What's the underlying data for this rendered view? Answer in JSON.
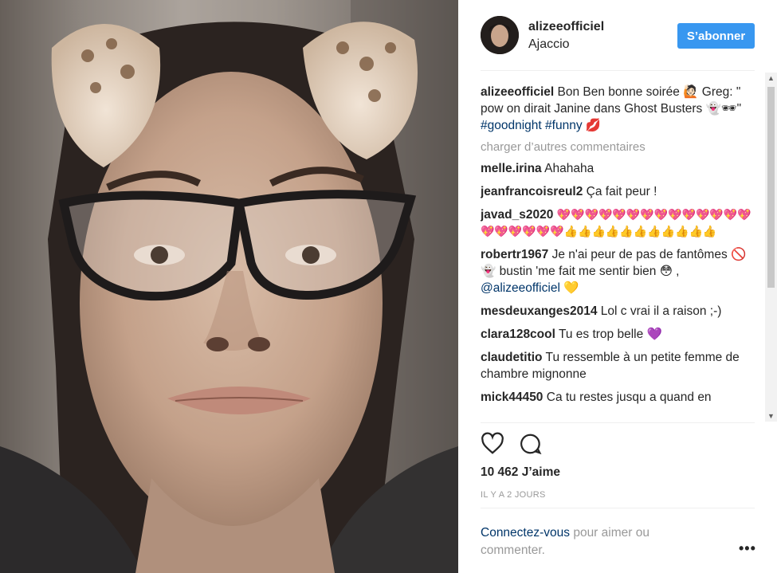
{
  "post": {
    "username": "alizeeofficiel",
    "location": "Ajaccio",
    "follow_label": "S’abonner",
    "caption": {
      "user": "alizeeofficiel",
      "text": "Bon Ben bonne soirée 🙋🏻 Greg: \" pow on dirait Janine dans Ghost Busters 👻🕶\" ",
      "tags": [
        "#goodnight",
        "#funny"
      ],
      "trail": " 💋"
    },
    "load_more": "charger d’autres commentaires",
    "comments": [
      {
        "user": "melle.irina",
        "text": "Ahahaha"
      },
      {
        "user": "jeanfrancoisreul2",
        "text": "Ça fait peur !"
      },
      {
        "user": "javad_s2020",
        "text": "💖💖💖💖💖💖💖💖💖💖💖💖💖💖💖💖💖💖💖💖👍👍👍👍👍👍👍👍👍👍👍"
      },
      {
        "user": "robertr1967",
        "text": "Je n'ai peur de pas de fantômes 🚫👻 bustin 'me fait me sentir bien 😳 , ",
        "mention": "@alizeeofficiel",
        "after": " 💛"
      },
      {
        "user": "mesdeuxanges2014",
        "text": "Lol c vrai il a raison ;-)"
      },
      {
        "user": "clara128cool",
        "text": "Tu es trop belle 💜"
      },
      {
        "user": "claudetitio",
        "text": "Tu ressemble à un petite femme de chambre mignonne"
      },
      {
        "user": "mick44450",
        "text": "Ca tu restes jusqu a quand en"
      }
    ],
    "likes": "10 462 J’aime",
    "time": "IL Y A 2 JOURS",
    "login_link": "Connectez-vous",
    "login_rest": " pour aimer ou commenter.",
    "more_icon": "•••"
  },
  "icons": {
    "like": "heart-icon",
    "comment": "comment-icon",
    "more": "more-options-icon"
  },
  "colors": {
    "accent": "#3897f0",
    "link": "#003569",
    "muted": "#999999"
  }
}
